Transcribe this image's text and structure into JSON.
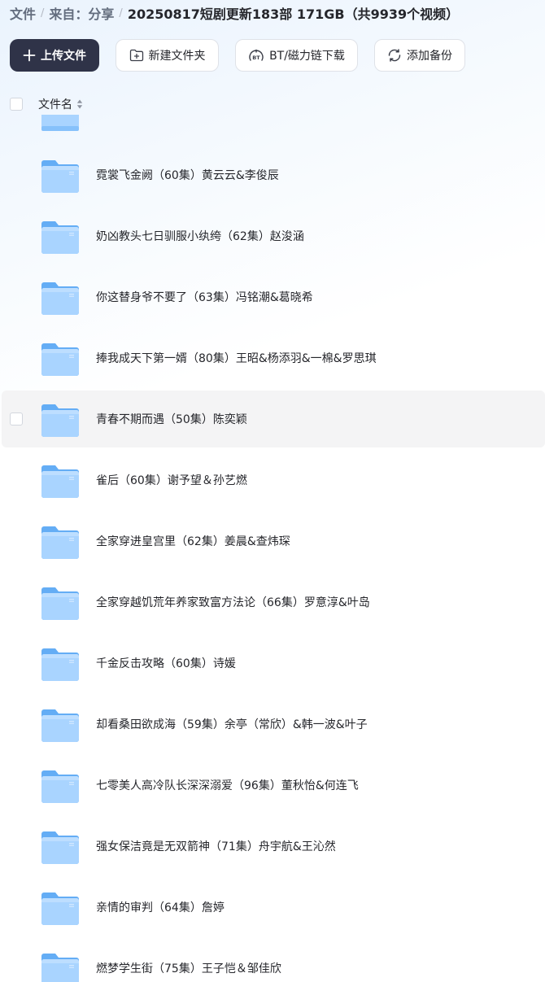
{
  "breadcrumb": {
    "items": [
      "文件",
      "来自：分享"
    ],
    "separator": "/",
    "current": "20250817短剧更新183部 171GB（共9939个视频）"
  },
  "toolbar": {
    "upload_label": "上传文件",
    "new_folder_label": "新建文件夹",
    "bt_label": "BT/磁力链下载",
    "backup_label": "添加备份"
  },
  "list": {
    "header_name": "文件名",
    "items": [
      {
        "name": "霓裳飞金阙（60集）黄云云&李俊辰"
      },
      {
        "name": "奶凶教头七日驯服小纨绔（62集）赵浚涵"
      },
      {
        "name": "你这替身爷不要了（63集）冯铭潮&葛晓希"
      },
      {
        "name": "捧我成天下第一婿（80集）王昭&杨添羽&一棉&罗思琪"
      },
      {
        "name": "青春不期而遇（50集）陈奕颖"
      },
      {
        "name": "雀后（60集）谢予望＆孙艺燃"
      },
      {
        "name": "全家穿进皇宫里（62集）姜晨&查炜琛"
      },
      {
        "name": "全家穿越饥荒年养家致富方法论（66集）罗意淳&叶岛"
      },
      {
        "name": "千金反击攻略（60集）诗媛"
      },
      {
        "name": "却看桑田欲成海（59集）余亭（常欣）&韩一波&叶子"
      },
      {
        "name": "七零美人高冷队长深深溺爱（96集）董秋怡&何连飞"
      },
      {
        "name": "强女保洁竟是无双箭神（71集）舟宇航&王沁然"
      },
      {
        "name": "亲情的审判（64集）詹婷"
      },
      {
        "name": "燃梦学生街（75集）王子恺＆邹佳欣"
      }
    ],
    "hovered_index": 4
  },
  "colors": {
    "primary_button": "#2f3348",
    "folder_light": "#a9d4ff",
    "folder_dark": "#64adf5",
    "hover_row": "#f4f4f5"
  },
  "icons": {
    "upload": "plus-icon",
    "new_folder": "folder-plus-icon",
    "bt": "bt-icon",
    "backup": "sync-circle-icon",
    "sort": "sort-icon",
    "folder": "folder-icon"
  }
}
